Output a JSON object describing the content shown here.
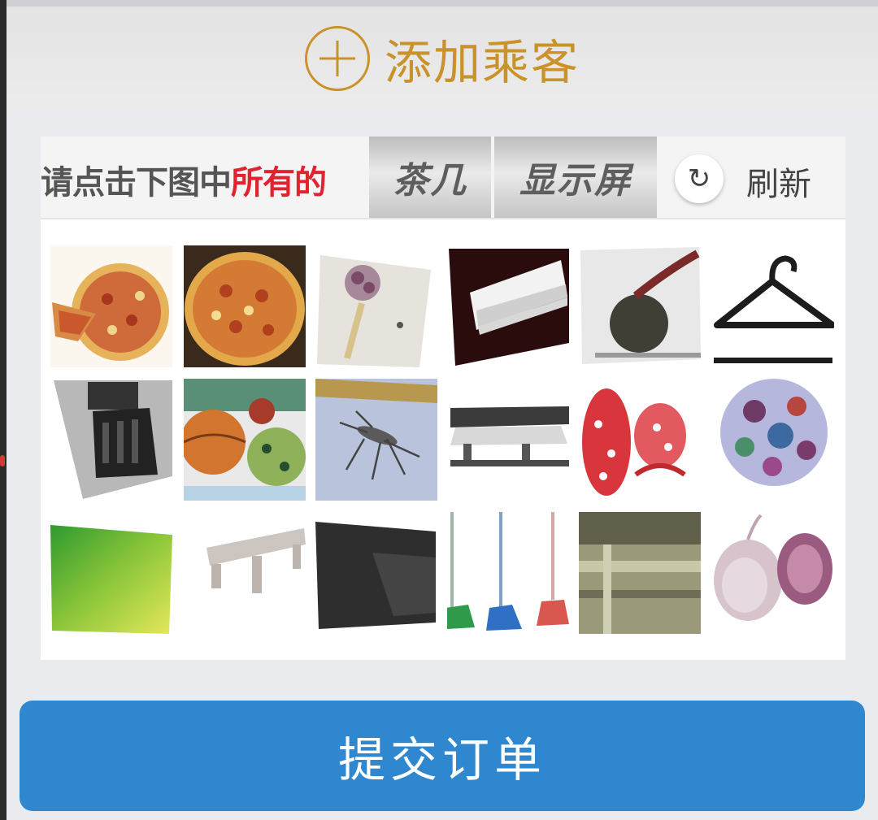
{
  "add_passenger": {
    "label": "添加乘客",
    "icon": "plus-circle-icon",
    "color": "#c9922a"
  },
  "captcha": {
    "prompt_prefix": "请点击下图中",
    "prompt_highlight": "所有的",
    "target_words": [
      "茶几",
      "显示屏"
    ],
    "refresh_label": "刷新",
    "refresh_icon": "refresh-icon",
    "refresh_glyph": "↻",
    "highlight_color": "#e0232f"
  },
  "submit": {
    "label": "提交订单",
    "color": "#2f88cf"
  }
}
